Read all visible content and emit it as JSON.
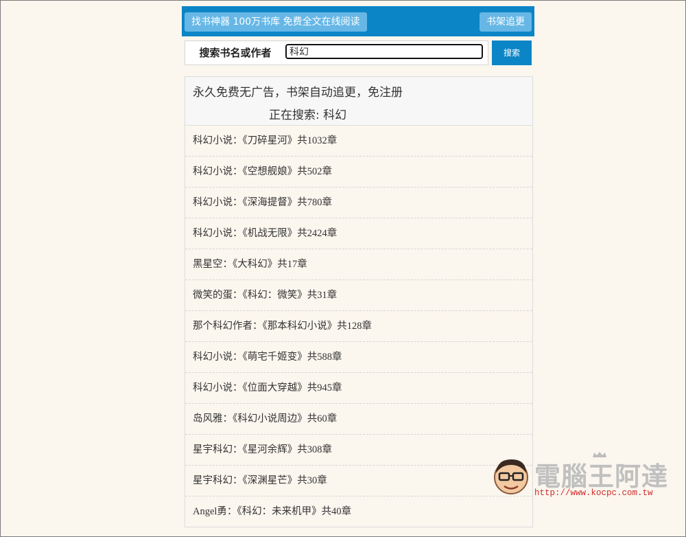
{
  "header": {
    "home_label": "找书神器 100万书库 免费全文在线阅读",
    "shelf_label": "书架追更"
  },
  "search": {
    "label": "搜索书名或作者",
    "value": "科幻",
    "button_label": "搜索"
  },
  "results": {
    "slogan": "永久免费无广告，书架自动追更，免注册",
    "searching_text": "正在搜索: 科幻",
    "items": [
      "科幻小说：《刀碎星河》共1032章",
      "科幻小说：《空想舰娘》共502章",
      "科幻小说：《深海提督》共780章",
      "科幻小说：《机战无限》共2424章",
      "黑星空：《大科幻》共17章",
      "微笑的蛋：《科幻：微笑》共31章",
      "那个科幻作者：《那本科幻小说》共128章",
      "科幻小说：《萌宅千姬变》共588章",
      "科幻小说：《位面大穿越》共945章",
      "岛风雅：《科幻小说周边》共60章",
      "星宇科幻：《星河余辉》共308章",
      "星宇科幻：《深渊星芒》共30章",
      "Angel勇：《科幻：未来机甲》共40章"
    ]
  },
  "watermark": {
    "brand": "電腦王阿達",
    "url": "http://www.kocpc.com.tw"
  },
  "colors": {
    "primary": "#0c85c6",
    "button_light": "#66b7e6",
    "page_bg": "#fbf6ee",
    "watermark_url": "#d02a2a"
  }
}
